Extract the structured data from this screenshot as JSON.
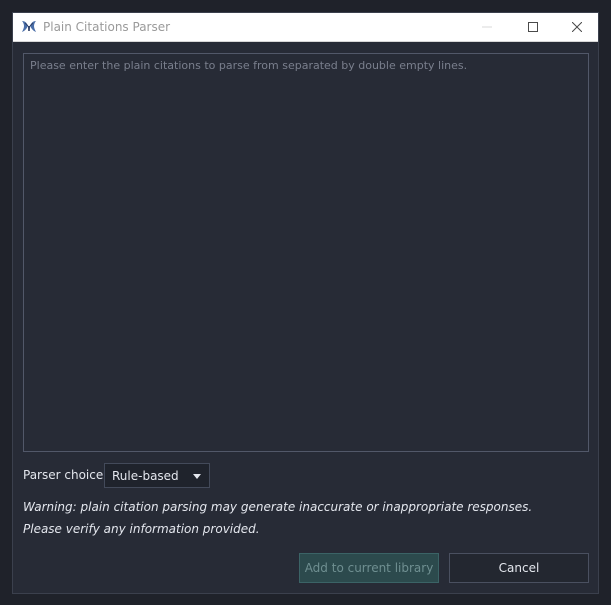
{
  "window": {
    "title": "Plain Citations Parser",
    "title_color": "#9a9a9a",
    "background": "#272b36",
    "titlebar_background": "#ffffff"
  },
  "icons": {
    "app": "jabref-logo-icon",
    "minimize": "minimize-icon",
    "maximize": "maximize-icon",
    "close": "close-icon"
  },
  "input": {
    "placeholder": "Please enter the plain citations to parse from separated by double empty lines.",
    "value": ""
  },
  "parser_choice": {
    "label": "Parser choice",
    "selected": "Rule-based"
  },
  "warning": {
    "line1": "Warning: plain citation parsing may generate inaccurate or inappropriate responses.",
    "line2": "Please verify any information provided."
  },
  "buttons": {
    "add": "Add to current library",
    "cancel": "Cancel",
    "add_state": "disabled"
  },
  "colors": {
    "accent_teal": "#2c4a4d",
    "text": "#e4e7ee",
    "placeholder": "#7a7f8d"
  }
}
